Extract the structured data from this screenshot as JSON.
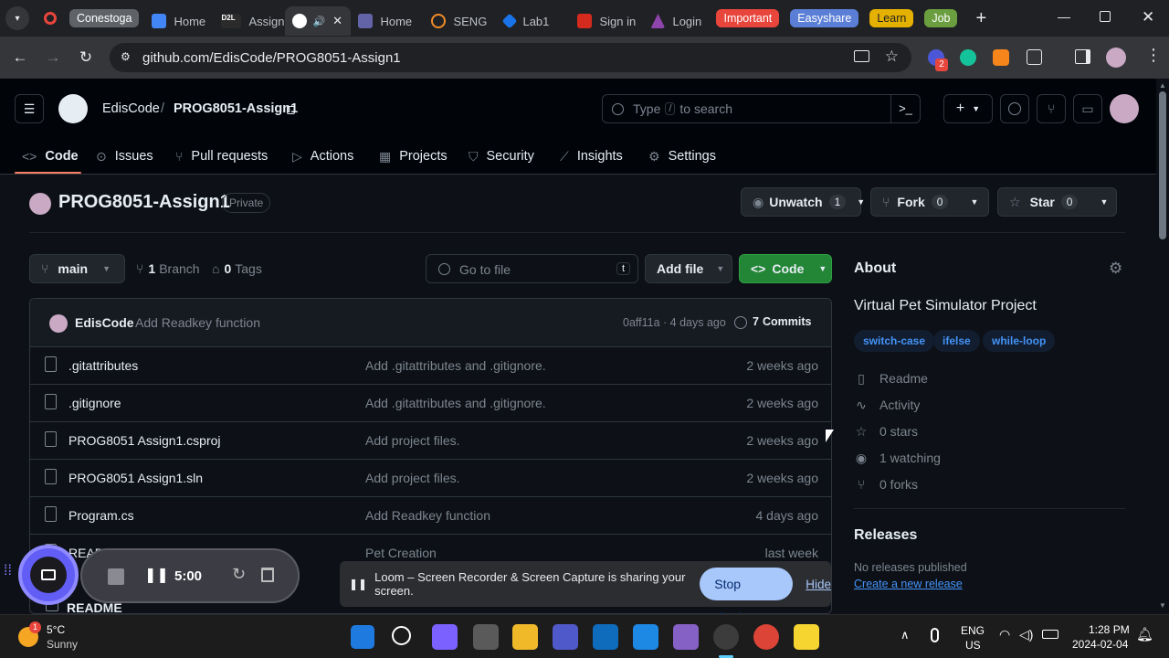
{
  "browser": {
    "tabs": [
      {
        "label": "",
        "type": "group-dot",
        "color": "#e8453c"
      },
      {
        "label": "Conestoga",
        "type": "group",
        "color": "#5f6368"
      },
      {
        "label": "Home",
        "color": "#4285f4"
      },
      {
        "label": "Assign",
        "color": "#2b2b2b",
        "fav_text": "D2L"
      },
      {
        "label": "",
        "active": true,
        "color": "#ffffff"
      },
      {
        "label": "Home",
        "color": "#6264a7"
      },
      {
        "label": "SENG",
        "color": "#f28c28"
      },
      {
        "label": "Lab1",
        "color": "#1a73e8"
      },
      {
        "label": "Sign in",
        "color": "#d52b1e"
      },
      {
        "label": "Login",
        "color": "#8e44ad"
      }
    ],
    "tab_groups": [
      {
        "label": "Important",
        "color": "#e8453c"
      },
      {
        "label": "Easyshare",
        "color": "#5b7fd6"
      },
      {
        "label": "Learn",
        "color": "#e5b100"
      },
      {
        "label": "Job",
        "color": "#6a9e3f"
      }
    ],
    "url": "github.com/EdisCode/PROG8051-Assign1",
    "extension_badge": "2"
  },
  "gh": {
    "owner": "EdisCode",
    "separator": "/",
    "repo": "PROG8051-Assign1",
    "search_prefix": "Type",
    "search_key": "/",
    "search_suffix": "to search",
    "nav": [
      "Code",
      "Issues",
      "Pull requests",
      "Actions",
      "Projects",
      "Security",
      "Insights",
      "Settings"
    ]
  },
  "repo": {
    "title": "PROG8051-Assign1",
    "visibility": "Private",
    "unwatch_label": "Unwatch",
    "watch_count": "1",
    "fork_label": "Fork",
    "fork_count": "0",
    "star_label": "Star",
    "star_count": "0",
    "branch": "main",
    "branch_count": "1",
    "branch_label": "Branch",
    "tag_count": "0",
    "tag_label": "Tags",
    "goto_placeholder": "Go to file",
    "goto_key": "t",
    "add_file_label": "Add file",
    "code_label": "Code"
  },
  "commit": {
    "author": "EdisCode",
    "message": "Add Readkey function",
    "hash_time": "0aff11a · 4 days ago",
    "commits_count": "7",
    "commits_label": "Commits"
  },
  "files": [
    {
      "name": ".gitattributes",
      "message": "Add .gitattributes and .gitignore.",
      "date": "2 weeks ago"
    },
    {
      "name": ".gitignore",
      "message": "Add .gitattributes and .gitignore.",
      "date": "2 weeks ago"
    },
    {
      "name": "PROG8051 Assign1.csproj",
      "message": "Add project files.",
      "date": "2 weeks ago"
    },
    {
      "name": "PROG8051 Assign1.sln",
      "message": "Add project files.",
      "date": "2 weeks ago"
    },
    {
      "name": "Program.cs",
      "message": "Add Readkey function",
      "date": "4 days ago"
    },
    {
      "name": "README.md",
      "message": "Pet Creation",
      "date": "last week"
    }
  ],
  "readme_label": "README",
  "about": {
    "heading": "About",
    "description": "Virtual Pet Simulator Project",
    "topics": [
      "switch-case",
      "ifelse",
      "while-loop"
    ],
    "items": [
      {
        "icon": "book-icon",
        "label": "Readme"
      },
      {
        "icon": "pulse-icon",
        "label": "Activity"
      },
      {
        "icon": "star-icon",
        "label": "0 stars"
      },
      {
        "icon": "eye-icon",
        "label": "1 watching"
      },
      {
        "icon": "fork-icon",
        "label": "0 forks"
      }
    ],
    "releases_heading": "Releases",
    "no_releases": "No releases published",
    "create_release": "Create a new release"
  },
  "recorder": {
    "time": "5:00"
  },
  "loom": {
    "message": "Loom – Screen Recorder & Screen Capture is sharing your screen.",
    "stop_label": "Stop sharing",
    "hide_label": "Hide"
  },
  "taskbar": {
    "weather_temp": "5°C",
    "weather_desc": "Sunny",
    "weather_badge": "1",
    "lang_top": "ENG",
    "lang_bottom": "US",
    "time": "1:28 PM",
    "date": "2024-02-04"
  }
}
